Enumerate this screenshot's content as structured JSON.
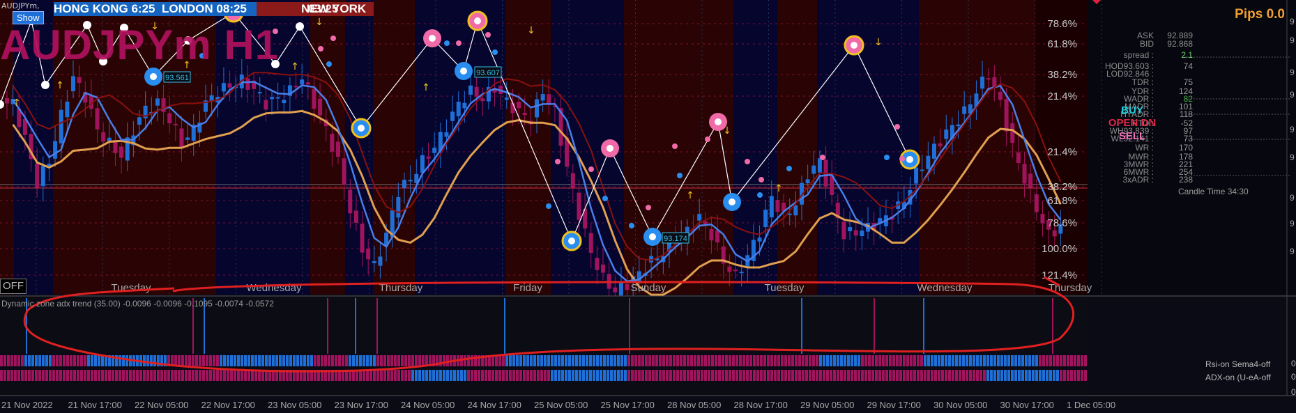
{
  "chart_data": {
    "type": "candlestick",
    "symbol_label": "AUDJPYm,",
    "watermark": "AUDJPYm H1",
    "fib_levels": [
      "78.6%",
      "61.8%",
      "38.2%",
      "21.4%",
      "21.4%",
      "38.2%",
      "61.8%",
      "78.6%",
      "100.0%",
      "121.4%"
    ],
    "price_tags": [
      "93.561",
      "93.607",
      "93.174"
    ],
    "day_labels": [
      "Tuesday",
      "Wednesday",
      "Thursday",
      "Friday",
      "Sunday",
      "Tuesday",
      "Wednesday",
      "Thursday"
    ],
    "time_labels": [
      "21 Nov 2022",
      "21 Nov 17:00",
      "22 Nov 05:00",
      "22 Nov 17:00",
      "23 Nov 05:00",
      "23 Nov 17:00",
      "24 Nov 05:00",
      "24 Nov 17:00",
      "25 Nov 05:00",
      "25 Nov 17:00",
      "28 Nov 05:00",
      "28 Nov 17:00",
      "29 Nov 05:00",
      "29 Nov 17:00",
      "30 Nov 05:00",
      "30 Nov 17:00",
      "1 Dec 05:00"
    ],
    "price_axis_ticks": [
      "9",
      "9",
      "9",
      "9",
      "9",
      "9",
      "9",
      "9",
      "9"
    ],
    "ylim": [
      92.9,
      94.5
    ],
    "close_series": [
      93.95,
      93.75,
      93.5,
      93.62,
      93.88,
      94.1,
      93.99,
      93.8,
      93.72,
      93.65,
      93.8,
      93.92,
      93.95,
      93.86,
      93.72,
      93.8,
      93.95,
      94.02,
      94.05,
      94.08,
      94.03,
      93.95,
      93.98,
      94.02,
      94.1,
      93.95,
      93.8,
      93.62,
      93.35,
      93.12,
      93.02,
      93.2,
      93.45,
      93.52,
      93.62,
      93.7,
      93.82,
      93.95,
      94.02,
      93.98,
      94.04,
      93.96,
      93.9,
      93.86,
      94.02,
      93.9,
      93.58,
      93.32,
      93.1,
      92.95,
      92.88,
      92.92,
      92.98,
      93.05,
      93.1,
      93.18,
      93.22,
      93.3,
      93.2,
      93.05,
      92.96,
      93.08,
      93.22,
      93.42,
      93.3,
      93.38,
      93.55,
      93.62,
      93.4,
      93.2,
      93.22,
      93.24,
      93.28,
      93.32,
      93.4,
      93.55,
      93.65,
      93.74,
      93.82,
      93.9,
      94.02,
      94.12,
      93.95,
      93.7,
      93.52,
      93.35,
      93.2,
      93.25
    ],
    "buy_arrows": 11,
    "sell_arrows": 5
  },
  "header": {
    "show_button": "Show",
    "sessions": [
      {
        "name": "HONG KONG",
        "time": "6:25",
        "color": "#1565c0"
      },
      {
        "name": "LONDON",
        "time": "08:25",
        "color": "#1565c0"
      },
      {
        "name": "NEW YORK",
        "time": "03:25",
        "color": "#b71c1c"
      }
    ]
  },
  "off_button": "OFF",
  "info": {
    "pips_label": "Pips 0.0",
    "ask_label": "ASK",
    "ask_value": "92.889",
    "bid_label": "BID",
    "bid_value": "92.868",
    "rows": [
      {
        "label": "spread :",
        "value": "2.1",
        "color": "#6ed46e"
      },
      {
        "label": "HOD93.603 :",
        "value": "74",
        "color": "#9a9a9a"
      },
      {
        "label": "LOD92.846 :",
        "value": "",
        "color": "#9a9a9a"
      },
      {
        "label": "TDR :",
        "value": "75",
        "color": "#9a9a9a"
      },
      {
        "label": "YDR :",
        "value": "124",
        "color": "#9a9a9a"
      },
      {
        "label": "WADR :",
        "value": "82",
        "color": "#3fae3f"
      },
      {
        "label": "MADR :",
        "value": "101",
        "color": "#9a9a9a"
      },
      {
        "label": "HYADR :",
        "value": "118",
        "color": "#9a9a9a"
      },
      {
        "label": "PTO :",
        "value": "-52",
        "color": "#9a9a9a"
      },
      {
        "label": "WH93.839 :",
        "value": "97",
        "color": "#9a9a9a"
      },
      {
        "label": "WL92.141 :",
        "value": "73",
        "color": "#9a9a9a"
      },
      {
        "label": "WR :",
        "value": "170",
        "color": "#9a9a9a"
      },
      {
        "label": "MWR :",
        "value": "178",
        "color": "#9a9a9a"
      },
      {
        "label": "3MWR :",
        "value": "221",
        "color": "#9a9a9a"
      },
      {
        "label": "6MWR :",
        "value": "254",
        "color": "#9a9a9a"
      },
      {
        "label": "3xADR :",
        "value": "238",
        "color": "#9a9a9a"
      }
    ],
    "buy_label": "BUY",
    "open_label": "OPEN DN",
    "sell_label": "SELL",
    "candle_time": "Candle Time 34:30"
  },
  "indicator": {
    "title": "Dynamic zone adx trend (35.00) -0.0096 -0.0096 -0.1095 -0.0074 -0.0572",
    "strip1_label": "Rsi-on   Sema4-off",
    "strip2_label": "ADX-on   (U-eA-off",
    "zero_a": "0",
    "zero_b": "0",
    "zero_c": "0"
  },
  "colors": {
    "bg_dark": "#05052e",
    "bg_red": "#2a0404",
    "bull": "#1f6fd8",
    "bear": "#a0145e",
    "orange_line": "#e0a050",
    "blue_line": "#4a7ee8",
    "fib_line": "#c01848",
    "annotation": "#e02020"
  }
}
